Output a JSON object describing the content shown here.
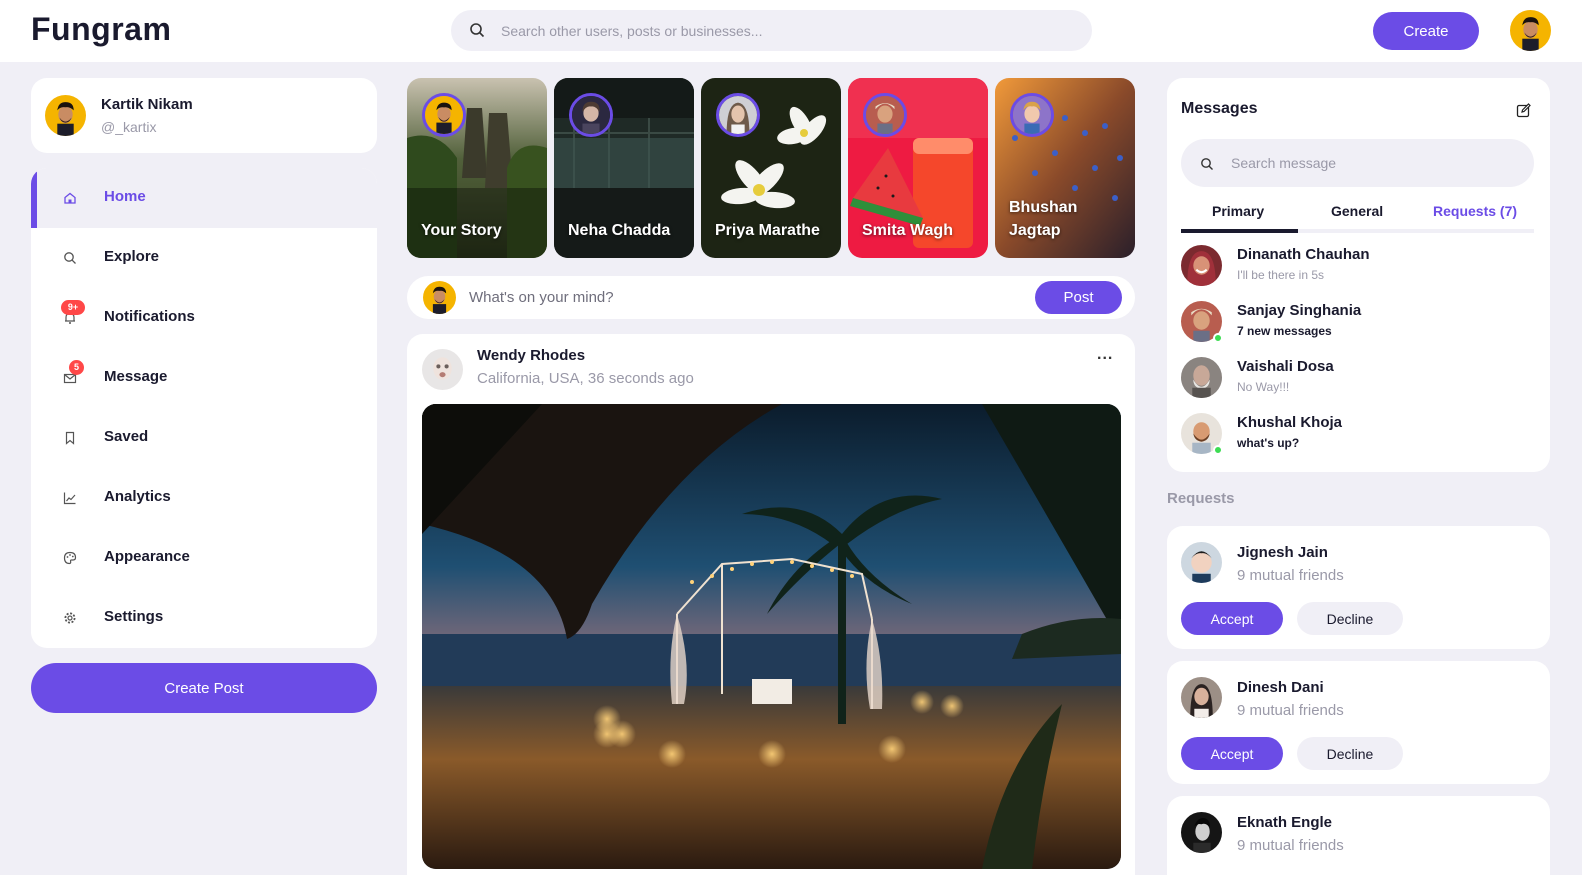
{
  "colors": {
    "accent": "#6b4ce6",
    "background": "#f0eff6",
    "badge": "#ff4848",
    "online": "#3ddc53"
  },
  "navbar": {
    "logo": "Fungram",
    "search_placeholder": "Search other users, posts or businesses...",
    "search_icon": "search-icon",
    "create_label": "Create"
  },
  "profile": {
    "name": "Kartik Nikam",
    "handle": "@_kartix"
  },
  "sidebar": {
    "items": [
      {
        "label": "Home",
        "icon": "home-icon",
        "active": true
      },
      {
        "label": "Explore",
        "icon": "search-icon"
      },
      {
        "label": "Notifications",
        "icon": "bell-icon",
        "badge": "9+"
      },
      {
        "label": "Message",
        "icon": "envelope-icon",
        "badge": "5"
      },
      {
        "label": "Saved",
        "icon": "bookmark-icon"
      },
      {
        "label": "Analytics",
        "icon": "chart-icon"
      },
      {
        "label": "Appearance",
        "icon": "palette-icon"
      },
      {
        "label": "Settings",
        "icon": "gear-icon"
      }
    ],
    "create_post_label": "Create Post"
  },
  "stories": [
    {
      "name": "Your Story"
    },
    {
      "name": "Neha Chadda"
    },
    {
      "name": "Priya Marathe"
    },
    {
      "name": "Smita Wagh"
    },
    {
      "name": "Bhushan Jagtap"
    }
  ],
  "compose": {
    "placeholder": "What's on your mind?",
    "post_label": "Post"
  },
  "feed": {
    "author": "Wendy Rhodes",
    "meta": "California, USA, 36 seconds ago",
    "more": "..."
  },
  "messages": {
    "title": "Messages",
    "search_placeholder": "Search message",
    "tabs": {
      "primary": "Primary",
      "general": "General",
      "requests": "Requests (7)"
    },
    "chats": [
      {
        "name": "Dinanath Chauhan",
        "message": "I'll be there in 5s",
        "online": false,
        "bold": false
      },
      {
        "name": "Sanjay Singhania",
        "message": "7 new messages",
        "online": true,
        "bold": true
      },
      {
        "name": "Vaishali Dosa",
        "message": "No Way!!!",
        "online": false,
        "bold": false
      },
      {
        "name": "Khushal Khoja",
        "message": "what's up?",
        "online": true,
        "bold": true
      }
    ]
  },
  "requests": {
    "heading": "Requests",
    "accept_label": "Accept",
    "decline_label": "Decline",
    "items": [
      {
        "name": "Jignesh Jain",
        "mutual": "9 mutual friends"
      },
      {
        "name": "Dinesh Dani",
        "mutual": "9 mutual friends"
      },
      {
        "name": "Eknath Engle",
        "mutual": "9 mutual friends"
      }
    ]
  }
}
